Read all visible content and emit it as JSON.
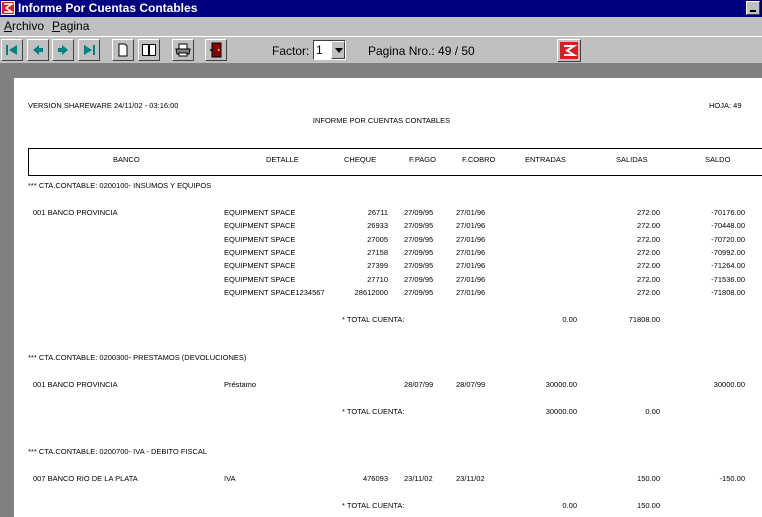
{
  "window": {
    "title": "Informe Por Cuentas Contables",
    "minimize_label": "_"
  },
  "menu": {
    "archivo_accel": "A",
    "archivo_rest": "rchivo",
    "pagina_accel": "P",
    "pagina_rest": "agina"
  },
  "toolbar": {
    "factor_label": "Factor:",
    "factor_value": "1",
    "page_label": "Pagina Nro.: 49 / 50"
  },
  "report": {
    "version": "VERSION SHAREWARE   24/11/02 - 03:16:00",
    "title": "INFORME POR CUENTAS CONTABLES",
    "sheet": "HOJA:  49",
    "columns": {
      "banco": "BANCO",
      "detalle": "DETALLE",
      "cheque": "CHEQUE",
      "fpago": "F.PAGO",
      "fcobro": "F.COBRO",
      "entradas": "ENTRADAS",
      "salidas": "SALIDAS",
      "saldo": "SALDO"
    },
    "sections": [
      {
        "account": "*** CTA.CONTABLE: 0200100- INSUMOS Y EQUIPOS",
        "bank": "001 BANCO PROVINCIA",
        "rows": [
          {
            "detalle": "EQUIPMENT SPACE",
            "cheque": "26711",
            "fpago": "27/09/95",
            "fcobro": "27/01/96",
            "entradas": "",
            "salidas": "272.00",
            "saldo": "-70176.00"
          },
          {
            "detalle": "EQUIPMENT SPACE",
            "cheque": "26933",
            "fpago": "27/09/95",
            "fcobro": "27/01/96",
            "entradas": "",
            "salidas": "272.00",
            "saldo": "-70448.00"
          },
          {
            "detalle": "EQUIPMENT SPACE",
            "cheque": "27005",
            "fpago": "27/09/95",
            "fcobro": "27/01/96",
            "entradas": "",
            "salidas": "272.00",
            "saldo": "-70720.00"
          },
          {
            "detalle": "EQUIPMENT SPACE",
            "cheque": "27158",
            "fpago": "27/09/95",
            "fcobro": "27/01/96",
            "entradas": "",
            "salidas": "272.00",
            "saldo": "-70992.00"
          },
          {
            "detalle": "EQUIPMENT SPACE",
            "cheque": "27399",
            "fpago": "27/09/95",
            "fcobro": "27/01/96",
            "entradas": "",
            "salidas": "272.00",
            "saldo": "-71264.00"
          },
          {
            "detalle": "EQUIPMENT SPACE",
            "cheque": "27710",
            "fpago": "27/09/95",
            "fcobro": "27/01/96",
            "entradas": "",
            "salidas": "272.00",
            "saldo": "-71536.00"
          },
          {
            "detalle": "EQUIPMENT SPACE1234567",
            "cheque": "28612000",
            "fpago": "27/09/95",
            "fcobro": "27/01/96",
            "entradas": "",
            "salidas": "272.00",
            "saldo": "-71808.00"
          }
        ],
        "total_label": "* TOTAL CUENTA:",
        "total_entradas": "0.00",
        "total_salidas": "71808.00"
      },
      {
        "account": "*** CTA.CONTABLE: 0200300- PRESTAMOS (DEVOLUCIONES)",
        "bank": "001 BANCO PROVINCIA",
        "rows": [
          {
            "detalle": "Préstamo",
            "cheque": "",
            "fpago": "28/07/99",
            "fcobro": "28/07/99",
            "entradas": "30000.00",
            "salidas": "",
            "saldo": "30000.00"
          }
        ],
        "total_label": "* TOTAL CUENTA:",
        "total_entradas": "30000.00",
        "total_salidas": "0.00"
      },
      {
        "account": "*** CTA.CONTABLE: 0200700- IVA - DEBITO FISCAL",
        "bank": "007 BANCO RIO DE LA PLATA",
        "rows": [
          {
            "detalle": "IVA",
            "cheque": "476093",
            "fpago": "23/11/02",
            "fcobro": "23/11/02",
            "entradas": "",
            "salidas": "150.00",
            "saldo": "-150.00"
          }
        ],
        "total_label": "* TOTAL CUENTA:",
        "total_entradas": "0.00",
        "total_salidas": "150.00"
      }
    ]
  },
  "colors": {
    "titlebar": "#000080",
    "face": "#c0c0c0",
    "logo_red": "#d81f1f",
    "viewport": "#808080"
  },
  "icons": [
    "app-logo-icon",
    "first-page-icon",
    "prev-page-icon",
    "next-page-icon",
    "last-page-icon",
    "single-page-icon",
    "two-pages-icon",
    "printer-icon",
    "exit-door-icon",
    "logo-icon"
  ]
}
